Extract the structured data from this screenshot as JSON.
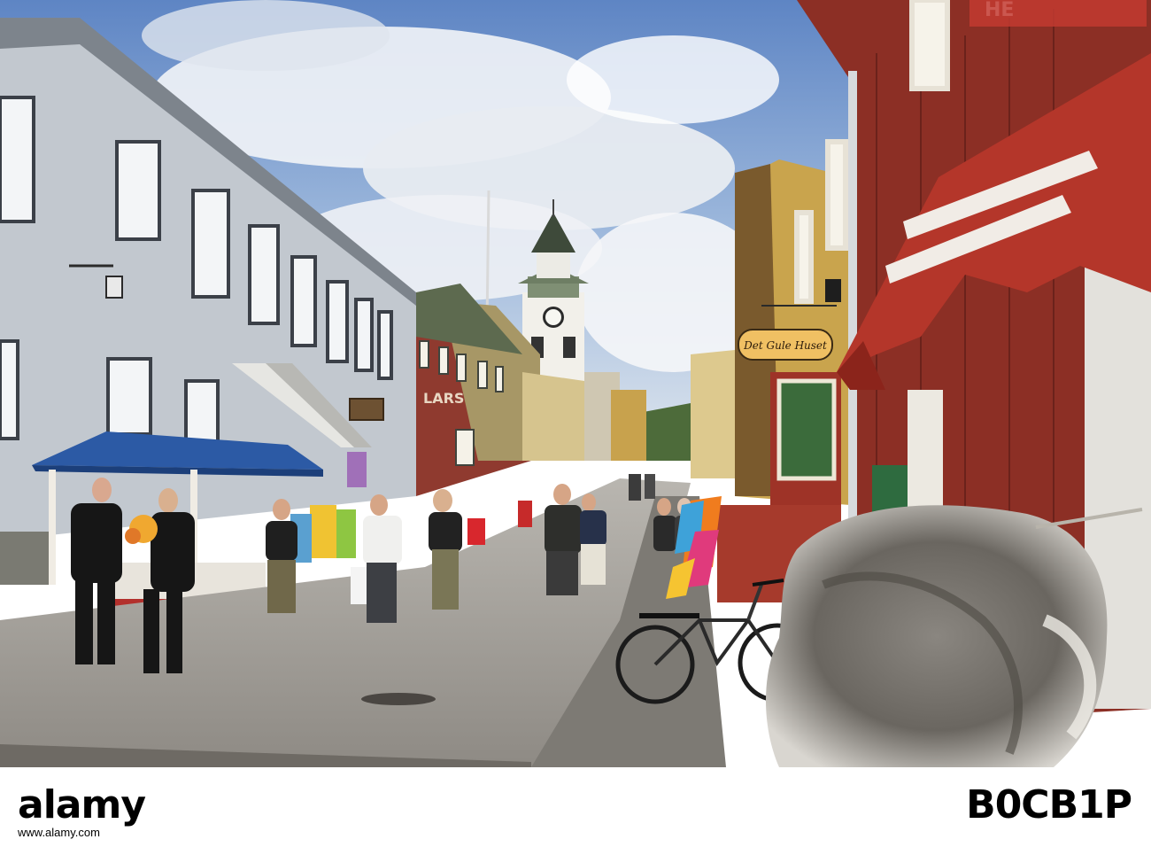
{
  "photo": {
    "shop_sign": "Det Gule Huset",
    "awning_text": "HE",
    "storefront_text": "LARS"
  },
  "footer": {
    "logo": "alamy",
    "url": "www.alamy.com",
    "image_id": "B0CB1P"
  }
}
